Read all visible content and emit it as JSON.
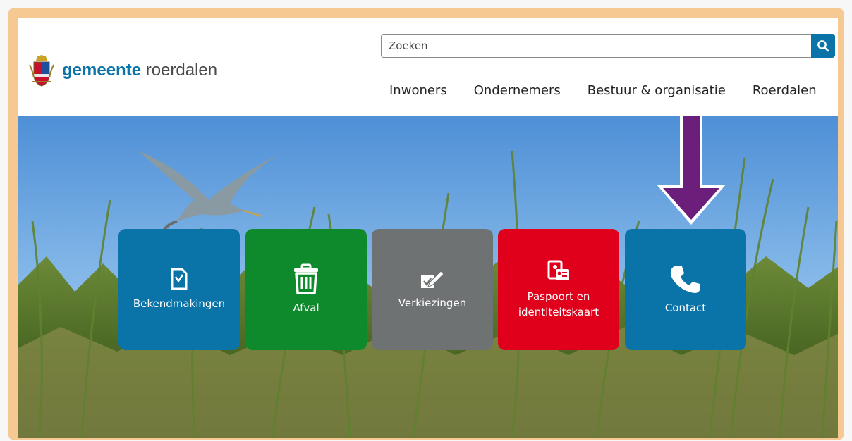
{
  "header": {
    "logo_text_bold": "gemeente",
    "logo_text_light": "roerdalen"
  },
  "search": {
    "placeholder": "Zoeken",
    "button_icon": "search-icon"
  },
  "nav": {
    "items": [
      {
        "label": "Inwoners"
      },
      {
        "label": "Ondernemers"
      },
      {
        "label": "Bestuur & organisatie"
      },
      {
        "label": "Roerdalen"
      }
    ]
  },
  "tiles": [
    {
      "label": "Bekendmakingen",
      "icon": "document-check-icon",
      "color": "#0a74a8"
    },
    {
      "label": "Afval",
      "icon": "trash-icon",
      "color": "#0e8a2c"
    },
    {
      "label": "Verkiezingen",
      "icon": "ballot-pencil-icon",
      "color": "#6f7272"
    },
    {
      "label_line1": "Paspoort en",
      "label_line2": "identiteitskaart",
      "icon": "id-card-icon",
      "color": "#e0001b"
    },
    {
      "label": "Contact",
      "icon": "phone-icon",
      "color": "#0a74a8"
    }
  ],
  "colors": {
    "brand_blue": "#0a74a8",
    "frame": "#f5c991",
    "annotation_arrow": "#6b1f7a"
  }
}
